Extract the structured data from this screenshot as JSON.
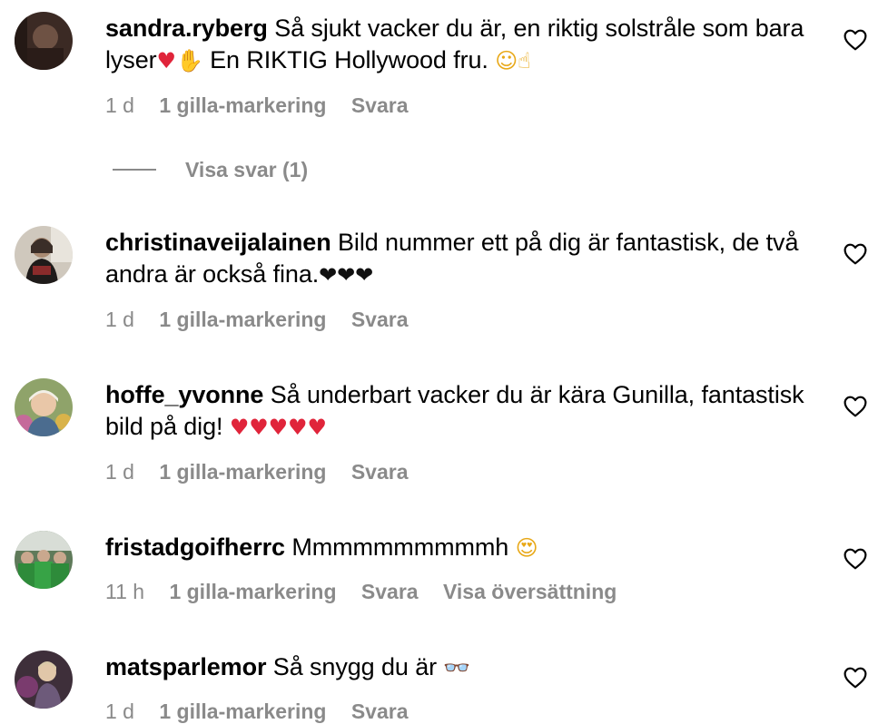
{
  "comments": [
    {
      "username": "sandra.ryberg",
      "text_part1": "Så sjukt vacker du är, en riktig solstråle som bara lyser",
      "text_part2": " En RIKTIG Hollywood fru. ",
      "time": "1 d",
      "likes": "1 gilla-markering",
      "reply": "Svara",
      "view_replies": "Visa svar (1)"
    },
    {
      "username": "christinaveijalainen",
      "text": "Bild nummer ett på dig är fantastisk, de två andra är också fina.",
      "time": "1 d",
      "likes": "1 gilla-markering",
      "reply": "Svara"
    },
    {
      "username": "hoffe_yvonne",
      "text": "Så underbart vacker du är kära Gunilla, fantastisk bild på dig! ",
      "time": "1 d",
      "likes": "1 gilla-markering",
      "reply": "Svara"
    },
    {
      "username": "fristadgoifherrc",
      "text": "Mmmmmmmmmmh ",
      "time": "11 h",
      "likes": "1 gilla-markering",
      "reply": "Svara",
      "translate": "Visa översättning"
    },
    {
      "username": "matsparlemor",
      "text": "Så snygg du är ",
      "time": "1 d",
      "likes": "1 gilla-markering",
      "reply": "Svara"
    }
  ],
  "colors": {
    "meta_gray": "#8a8a8a",
    "heart_red": "#e0243a"
  },
  "icons": {
    "like": "heart-outline-icon",
    "avatar": "profile-avatar"
  }
}
